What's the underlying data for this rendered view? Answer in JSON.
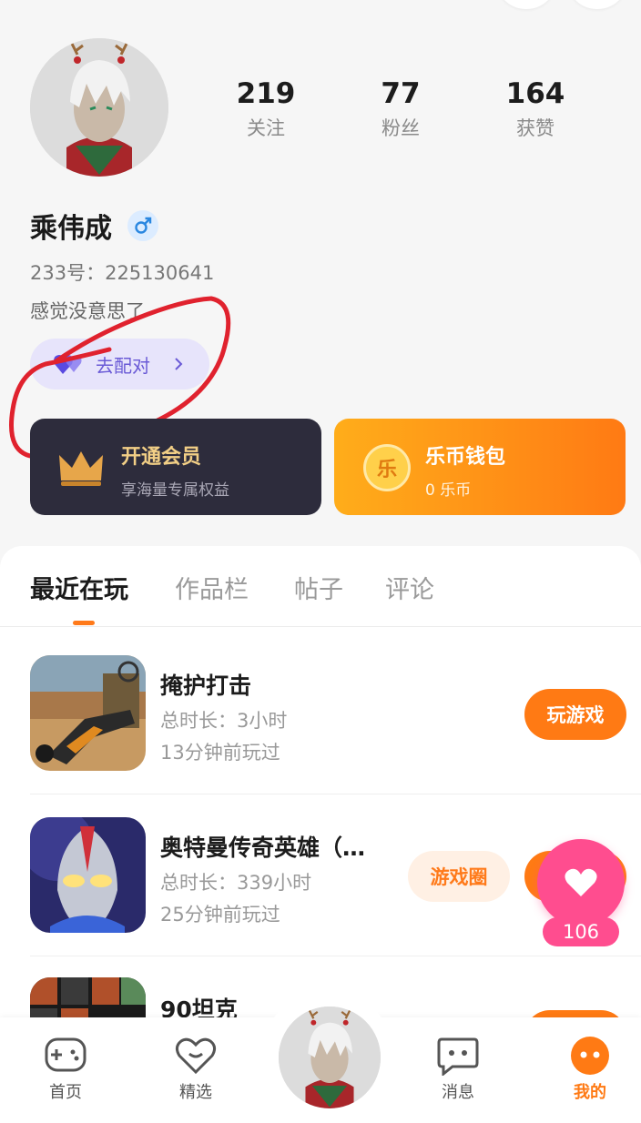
{
  "profile": {
    "username": "乘伟成",
    "uid_text": "233号：225130641",
    "bio": "感觉没意思了",
    "match_button": "去配对"
  },
  "stats": [
    {
      "value": "219",
      "label": "关注"
    },
    {
      "value": "77",
      "label": "粉丝"
    },
    {
      "value": "164",
      "label": "获赞"
    }
  ],
  "cards": {
    "vip": {
      "title": "开通会员",
      "subtitle": "享海量专属权益"
    },
    "wallet": {
      "title": "乐币钱包",
      "subtitle": "0 乐币",
      "coin_glyph": "乐"
    }
  },
  "tabs": [
    "最近在玩",
    "作品栏",
    "帖子",
    "评论"
  ],
  "games": [
    {
      "name": "掩护打击",
      "duration": "总时长：3小时",
      "last_played": "13分钟前玩过",
      "play_label": "玩游戏"
    },
    {
      "name": "奥特曼传奇英雄（…",
      "duration": "总时长：339小时",
      "last_played": "25分钟前玩过",
      "circle_label": "游戏圈",
      "play_label": "玩游戏"
    },
    {
      "name": "90坦克"
    }
  ],
  "like_count": "106",
  "bottom_nav": [
    {
      "label": "首页",
      "icon": "gamepad-icon"
    },
    {
      "label": "精选",
      "icon": "heart-chat-icon"
    },
    {
      "label": "消息",
      "icon": "message-icon"
    },
    {
      "label": "我的",
      "icon": "profile-icon"
    }
  ],
  "colors": {
    "accent": "#ff7a14",
    "like": "#ff4d8f",
    "match": "#6a5ad6",
    "gender": "#2a87e0"
  }
}
